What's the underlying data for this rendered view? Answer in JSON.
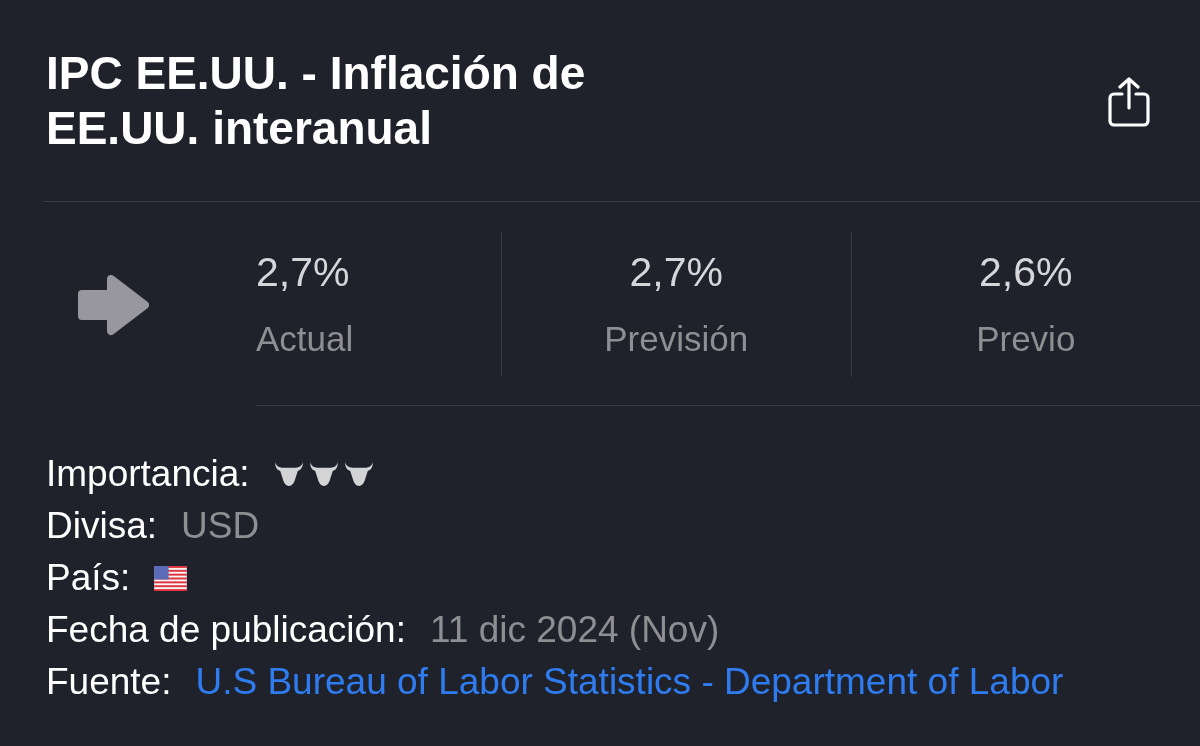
{
  "title": "IPC EE.UU. - Inflación de EE.UU. interanual",
  "stats": [
    {
      "value": "2,7%",
      "label": "Actual"
    },
    {
      "value": "2,7%",
      "label": "Previsión"
    },
    {
      "value": "2,6%",
      "label": "Previo"
    }
  ],
  "details": [
    {
      "kind": "importance",
      "label": "Importancia:",
      "stars": 3
    },
    {
      "kind": "text",
      "label": "Divisa:",
      "value": "USD"
    },
    {
      "kind": "flag",
      "label": "País:"
    },
    {
      "kind": "text",
      "label": "Fecha de publicación:",
      "value": "11 dic 2024 (Nov)"
    },
    {
      "kind": "link",
      "label": "Fuente:",
      "value": "U.S Bureau of Labor Statistics - Department of Labor"
    }
  ]
}
